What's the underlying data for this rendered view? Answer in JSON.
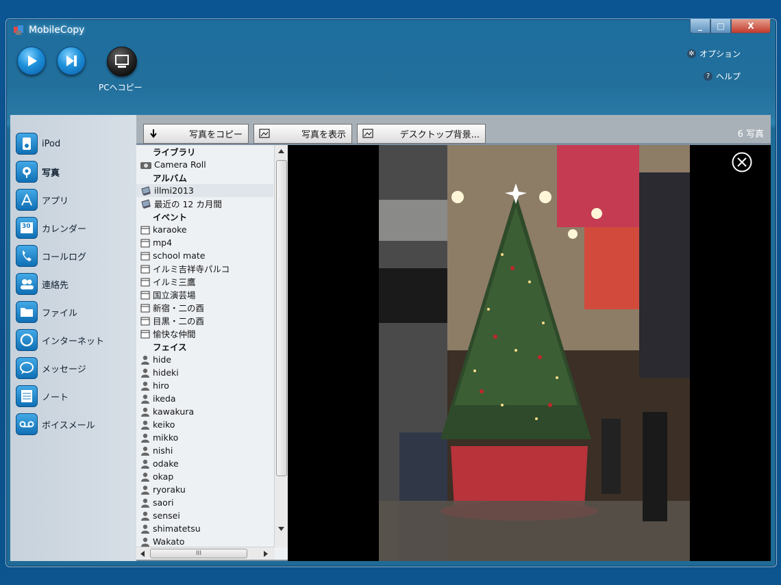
{
  "window": {
    "title": "MobileCopy",
    "btn_min": "_",
    "btn_max": "□",
    "btn_close": "X"
  },
  "header": {
    "pc_copy_label": "PCへコピー",
    "options_label": "オプション",
    "help_label": "ヘルプ"
  },
  "sidebar": {
    "items": [
      {
        "label": "iPod",
        "icon": "ipod-icon"
      },
      {
        "label": "写真",
        "icon": "photo-icon"
      },
      {
        "label": "アプリ",
        "icon": "app-icon"
      },
      {
        "label": "カレンダー",
        "icon": "calendar-icon",
        "badge": "30"
      },
      {
        "label": "コールログ",
        "icon": "phone-icon"
      },
      {
        "label": "連絡先",
        "icon": "contacts-icon"
      },
      {
        "label": "ファイル",
        "icon": "folder-icon"
      },
      {
        "label": "インターネット",
        "icon": "globe-icon"
      },
      {
        "label": "メッセージ",
        "icon": "message-icon"
      },
      {
        "label": "ノート",
        "icon": "note-icon"
      },
      {
        "label": "ボイスメール",
        "icon": "voicemail-icon"
      }
    ]
  },
  "toolbar": {
    "copy_photo": "写真をコピー",
    "show_photo": "写真を表示",
    "desktop_bg": "デスクトップ背景...",
    "photo_count": "6 写真"
  },
  "list": {
    "library_head": "ライブラリ",
    "camera_roll": "Camera Roll",
    "album_head": "アルバム",
    "albums": [
      "illmi2013",
      "最近の 12 カ月間"
    ],
    "event_head": "イベント",
    "events": [
      "karaoke",
      "mp4",
      "school mate",
      "イルミ吉祥寺パルコ",
      "イルミ三鷹",
      "国立演芸場",
      "新宿・二の酉",
      "目黒・二の酉",
      "愉快な仲間"
    ],
    "face_head": "フェイス",
    "faces": [
      "hide",
      "hideki",
      "hiro",
      "ikeda",
      "kawakura",
      "keiko",
      "mikko",
      "nishi",
      "odake",
      "okap",
      "ryoraku",
      "saori",
      "sensei",
      "shimatetsu",
      "Wakato"
    ],
    "hscroll_grip": "III"
  }
}
